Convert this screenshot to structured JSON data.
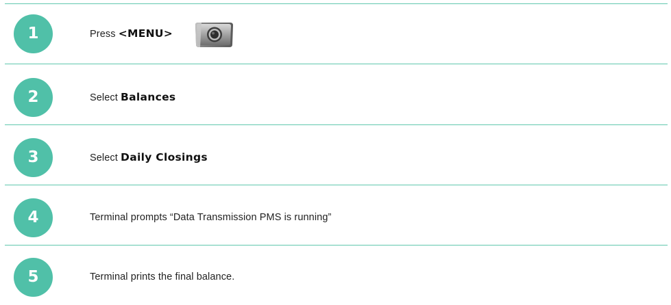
{
  "steps": [
    {
      "number": "1",
      "prefix": "Press",
      "strong": "<MENU>",
      "icon": "menu-key-icon"
    },
    {
      "number": "2",
      "prefix": "Select",
      "strong": "Balances"
    },
    {
      "number": "3",
      "prefix": "Select",
      "strong": "Daily Closings"
    },
    {
      "number": "4",
      "text": "Terminal prompts “Data Transmission PMS is running”"
    },
    {
      "number": "5",
      "text": "Terminal prints the final balance."
    }
  ],
  "colors": {
    "accent": "#50c0a8",
    "rule": "#5fc7ad",
    "text": "#222222"
  }
}
